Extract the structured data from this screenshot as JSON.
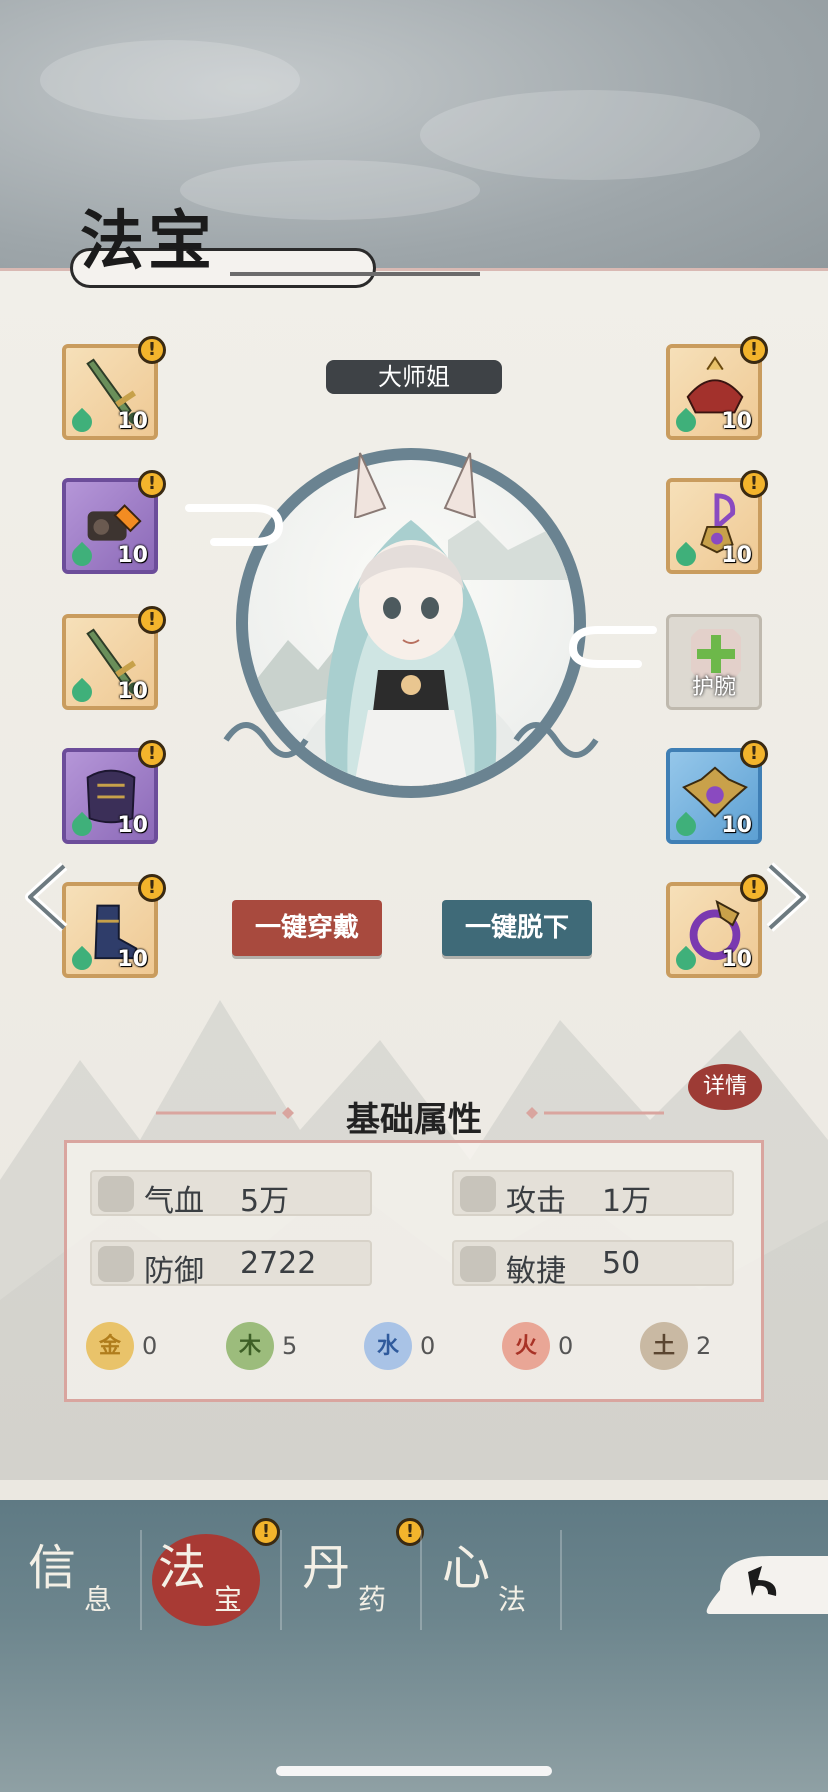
{
  "screen_title": "法宝",
  "character_name": "大师姐",
  "left_slots": [
    {
      "id": "l1",
      "rarity": "gold",
      "item": "jade-sword",
      "level": "10",
      "alert": "!"
    },
    {
      "id": "l2",
      "rarity": "purple",
      "item": "orange-gourd",
      "level": "10",
      "alert": "!"
    },
    {
      "id": "l3",
      "rarity": "gold",
      "item": "jade-sword",
      "level": "10",
      "alert": "!"
    },
    {
      "id": "l4",
      "rarity": "purple",
      "item": "dark-armor",
      "level": "10",
      "alert": "!"
    },
    {
      "id": "l5",
      "rarity": "gold",
      "item": "blue-boots",
      "level": "10",
      "alert": "!"
    }
  ],
  "right_slots": [
    {
      "id": "r1",
      "rarity": "gold",
      "item": "red-headdress",
      "level": "10",
      "alert": "!"
    },
    {
      "id": "r2",
      "rarity": "gold",
      "item": "purple-pendant",
      "level": "10",
      "alert": "!"
    },
    {
      "id": "r3",
      "rarity": "empty",
      "label": "护腕"
    },
    {
      "id": "r4",
      "rarity": "blue",
      "item": "gold-amulet",
      "level": "10",
      "alert": "!"
    },
    {
      "id": "r5",
      "rarity": "gold",
      "item": "dragon-ring",
      "level": "10",
      "alert": "!"
    }
  ],
  "buttons": {
    "wear_all": "一键穿戴",
    "remove_all": "一键脱下",
    "detail": "详情"
  },
  "attributes": {
    "title": "基础属性",
    "stats": [
      {
        "name": "气血",
        "value": "5万",
        "icon": "blood-icon"
      },
      {
        "name": "攻击",
        "value": "1万",
        "icon": "attack-icon"
      },
      {
        "name": "防御",
        "value": "2722",
        "icon": "shield-icon"
      },
      {
        "name": "敏捷",
        "value": "50",
        "icon": "agility-icon"
      }
    ],
    "elements": [
      {
        "glyph": "金",
        "value": "0",
        "color": "#e9c36a",
        "text_color": "#b07d1c"
      },
      {
        "glyph": "木",
        "value": "5",
        "color": "#9cbc7c",
        "text_color": "#3d5f26"
      },
      {
        "glyph": "水",
        "value": "0",
        "color": "#a9c3e6",
        "text_color": "#2f5a9c"
      },
      {
        "glyph": "火",
        "value": "0",
        "color": "#e9a696",
        "text_color": "#a83226"
      },
      {
        "glyph": "土",
        "value": "2",
        "color": "#c9b9a3",
        "text_color": "#5a4530"
      }
    ]
  },
  "tabs": [
    {
      "big": "信",
      "small": "息",
      "active": false,
      "alert": ""
    },
    {
      "big": "法",
      "small": "宝",
      "active": true,
      "alert": "!"
    },
    {
      "big": "丹",
      "small": "药",
      "active": false,
      "alert": "!"
    },
    {
      "big": "心",
      "small": "法",
      "active": false,
      "alert": ""
    }
  ]
}
